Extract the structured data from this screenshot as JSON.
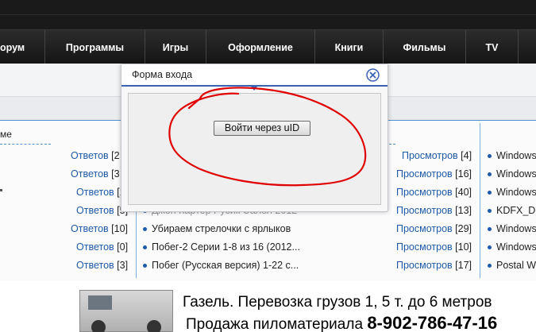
{
  "nav": {
    "items": [
      {
        "label": "орум"
      },
      {
        "label": "Программы"
      },
      {
        "label": "Игры"
      },
      {
        "label": "Оформление"
      },
      {
        "label": "Книги"
      },
      {
        "label": "Фильмы"
      },
      {
        "label": "TV"
      }
    ]
  },
  "tabs": {
    "partial_label": "ме"
  },
  "forum_stats": [
    {
      "link": "Ответов",
      "value": "[2"
    },
    {
      "link": "Ответов",
      "value": "[3"
    },
    {
      "link": "Ответов",
      "value": "[1"
    },
    {
      "link": "Ответов",
      "value": "[5]"
    },
    {
      "link": "Ответов",
      "value": "[10]"
    },
    {
      "link": "Ответов",
      "value": "[0]"
    },
    {
      "link": "Ответов",
      "value": "[3]"
    }
  ],
  "topics": [
    {
      "title": "Джон Картер  Русик   Салел  2012"
    },
    {
      "title": "Убираем стрелочки с ярлыков"
    },
    {
      "title": "Побег-2 Серии 1-8 из 16 (2012..."
    },
    {
      "title": "Побег (Русская версия) 1-22 с..."
    }
  ],
  "views": [
    {
      "link": "Просмотров",
      "value": "[4]"
    },
    {
      "link": "Просмотров",
      "value": "[16]"
    },
    {
      "link": "Просмотров",
      "value": "[40]"
    },
    {
      "link": "Просмотров",
      "value": "[13]"
    },
    {
      "link": "Просмотров",
      "value": "[29]"
    },
    {
      "link": "Просмотров",
      "value": "[10]"
    },
    {
      "link": "Просмотров",
      "value": "[17]"
    }
  ],
  "right_list": [
    {
      "title": "Windows"
    },
    {
      "title": "Windows"
    },
    {
      "title": "Windows"
    },
    {
      "title": "KDFX_D"
    },
    {
      "title": "Windows"
    },
    {
      "title": "Windows"
    },
    {
      "title": "Postal W"
    }
  ],
  "modal": {
    "title": "Форма входа",
    "login_button": "Войти через uID"
  },
  "banner": {
    "line1": "Газель. Перевозка грузов 1, 5 т. до 6 метров",
    "line2_text": "Продажа пиломатериала",
    "line2_phone": "8-902-786-47-16"
  },
  "colors": {
    "nav_bg": "#1a1a1a",
    "link": "#1e5aa8",
    "accent_blue": "#3b63b4",
    "scribble_red": "#e00000"
  },
  "icons": {
    "close": "close-circle-icon"
  }
}
